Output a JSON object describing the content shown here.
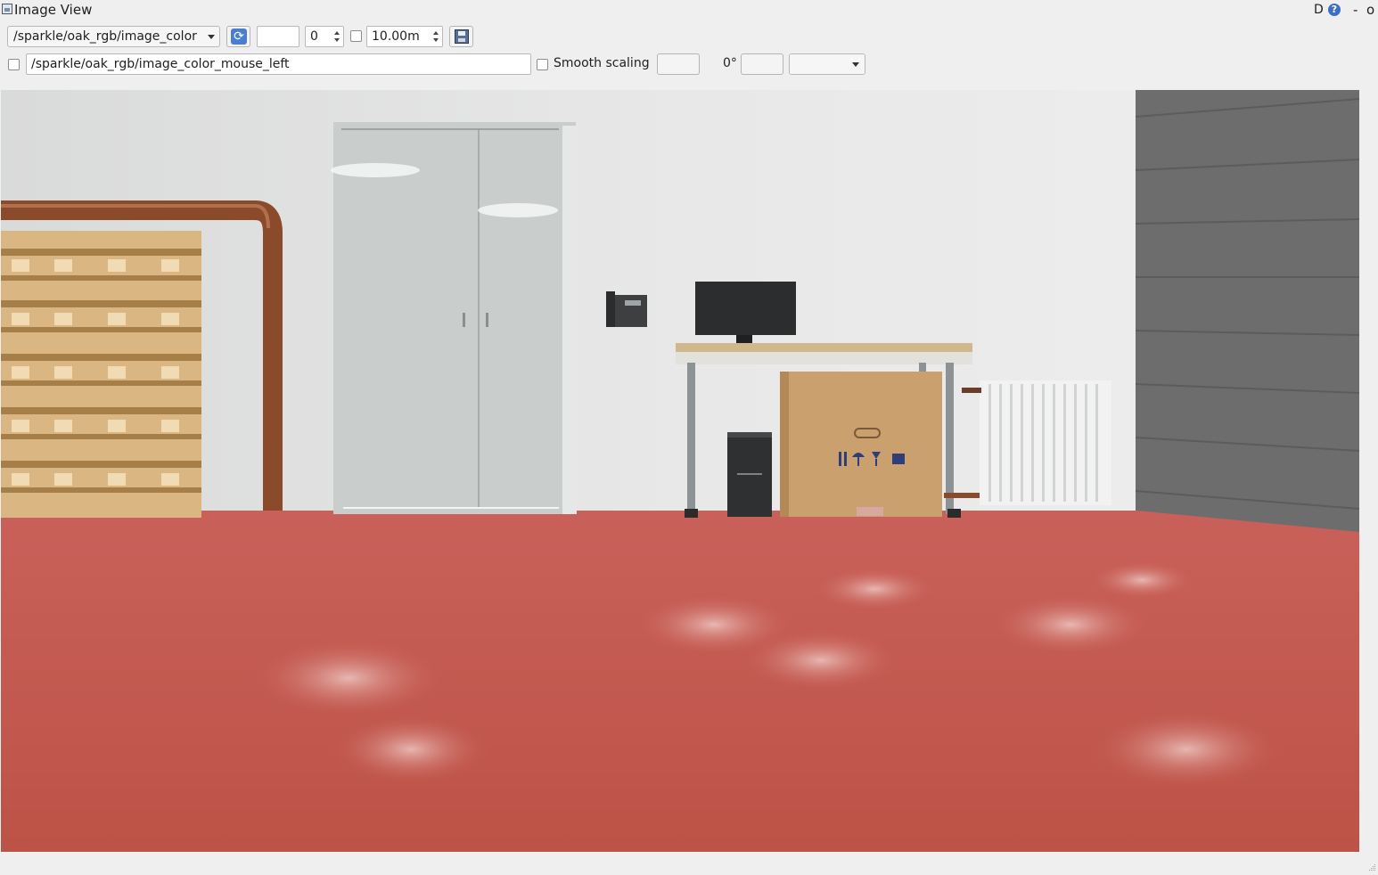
{
  "window": {
    "title": "Image View",
    "controls": {
      "d_label": "D",
      "help": "?",
      "minimize": "-",
      "close": "o"
    }
  },
  "toolbar": {
    "topic_value": "/sparkle/oak_rgb/image_color",
    "min_value": "",
    "number_value": "0",
    "max_depth_value": "10.00m",
    "mouse_topic_value": "/sparkle/oak_rgb/image_color_mouse_left",
    "smooth_scaling_label": "Smooth scaling",
    "rotation_label": "0°",
    "refresh_icon": "refresh-icon",
    "save_icon": "save-icon"
  },
  "image": {
    "description_icon": "camera-frame",
    "colors": {
      "wall": "#dedfdf",
      "floor": "#c65a4f",
      "pipe": "#8b4a2a",
      "cabinet": "#c9cdcb",
      "concrete": "#6d6d6d",
      "box": "#c9a06e",
      "pallet": "#d9b682"
    }
  }
}
